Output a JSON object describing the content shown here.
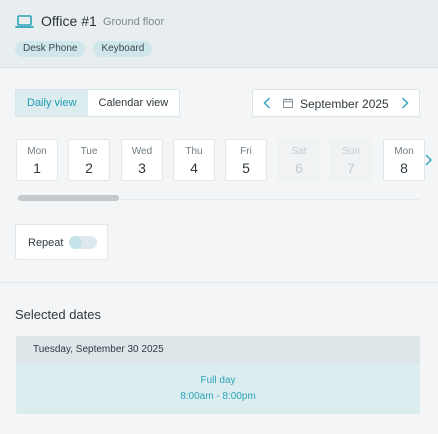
{
  "header": {
    "title": "Office #1",
    "subtitle": "Ground floor",
    "tags": [
      "Desk Phone",
      "Keyboard"
    ]
  },
  "view_toggle": {
    "daily_label": "Daily view",
    "calendar_label": "Calendar view",
    "active": "daily"
  },
  "month_nav": {
    "label": "September 2025"
  },
  "days": [
    {
      "name": "Mon",
      "date": "1",
      "disabled": false
    },
    {
      "name": "Tue",
      "date": "2",
      "disabled": false
    },
    {
      "name": "Wed",
      "date": "3",
      "disabled": false
    },
    {
      "name": "Thu",
      "date": "4",
      "disabled": false
    },
    {
      "name": "Fri",
      "date": "5",
      "disabled": false
    },
    {
      "name": "Sat",
      "date": "6",
      "disabled": true
    },
    {
      "name": "Sun",
      "date": "7",
      "disabled": true
    },
    {
      "name": "Mon",
      "date": "8",
      "disabled": false
    }
  ],
  "repeat": {
    "label": "Repeat",
    "enabled": false
  },
  "selected": {
    "section_title": "Selected dates",
    "date": "Tuesday, September 30 2025",
    "type": "Full day",
    "time": "8:00am - 8:00pm"
  },
  "colors": {
    "accent": "#2ca4b8",
    "tag_bg": "#cfe6ea"
  },
  "icons": {
    "office": "laptop-icon",
    "calendar": "calendar-icon",
    "prev": "chevron-left-icon",
    "next": "chevron-right-icon"
  }
}
